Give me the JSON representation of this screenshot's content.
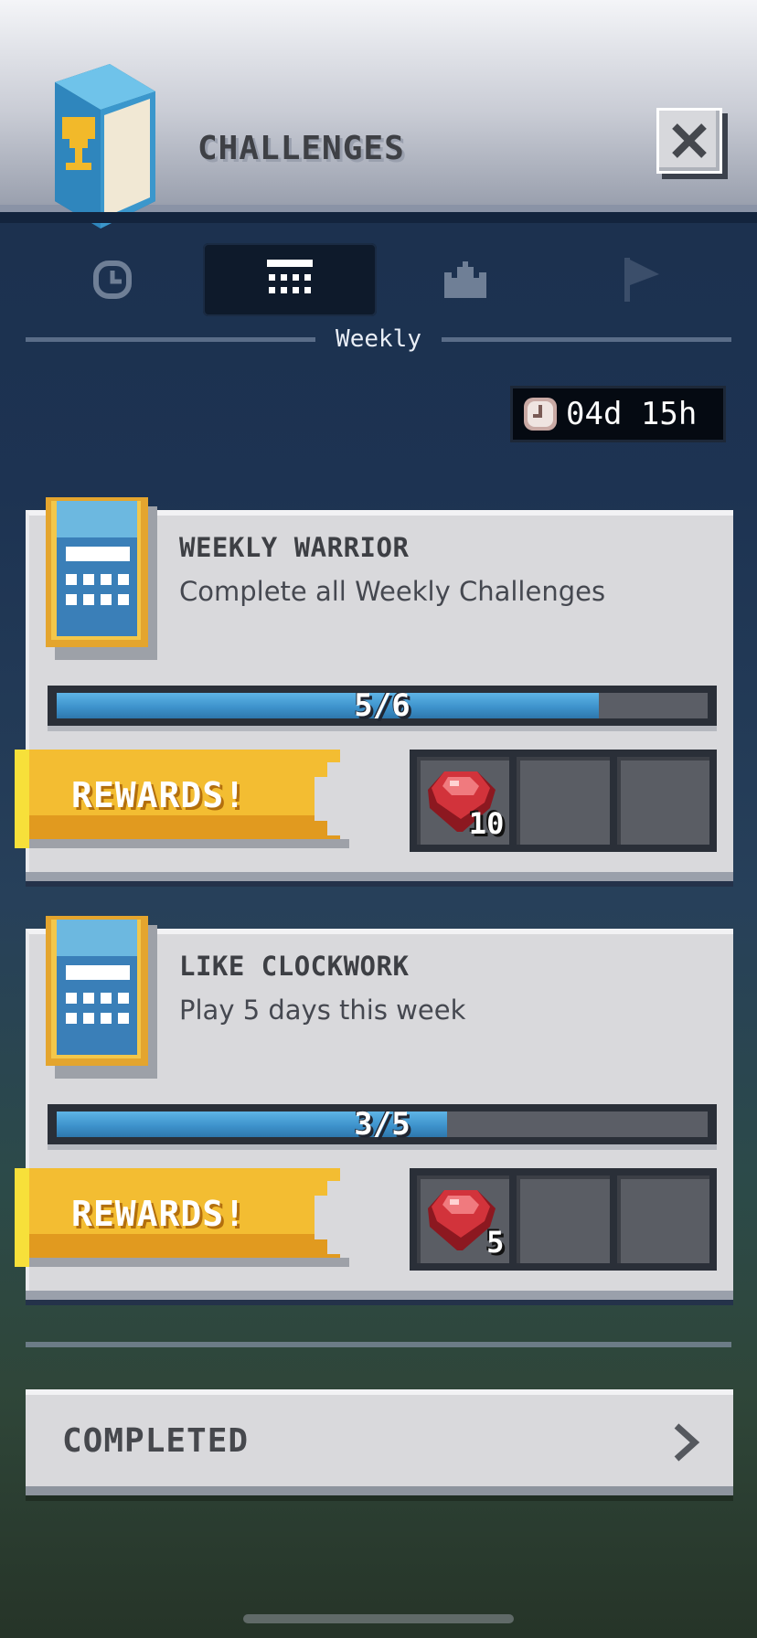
{
  "header": {
    "title": "CHALLENGES",
    "close_icon": "close-icon",
    "book_icon": "trophy-book-icon"
  },
  "tabs": {
    "items": [
      {
        "icon": "clock-icon",
        "active": false
      },
      {
        "icon": "calendar-icon",
        "active": true
      },
      {
        "icon": "crown-icon",
        "active": false
      },
      {
        "icon": "flag-icon",
        "active": false
      }
    ],
    "active_label": "Weekly"
  },
  "timer": {
    "icon": "clock-icon",
    "text": "04d 15h"
  },
  "challenges": [
    {
      "title": "WEEKLY WARRIOR",
      "description": "Complete all Weekly Challenges",
      "progress_text": "5/6",
      "progress_fraction": 0.833,
      "rewards_label": "REWARDS!",
      "reward_icon": "ruby-gem-icon",
      "reward_count": "10"
    },
    {
      "title": "LIKE CLOCKWORK",
      "description": "Play 5 days this week",
      "progress_text": "3/5",
      "progress_fraction": 0.6,
      "rewards_label": "REWARDS!",
      "reward_icon": "ruby-gem-icon",
      "reward_count": "5"
    }
  ],
  "completed": {
    "label": "COMPLETED",
    "icon": "chevron-right-icon"
  },
  "colors": {
    "progress_blue": "#3e93cc",
    "rewards_gold": "#f0b12a",
    "card_bg": "#d9d9dc",
    "ruby": "#c9282f"
  }
}
